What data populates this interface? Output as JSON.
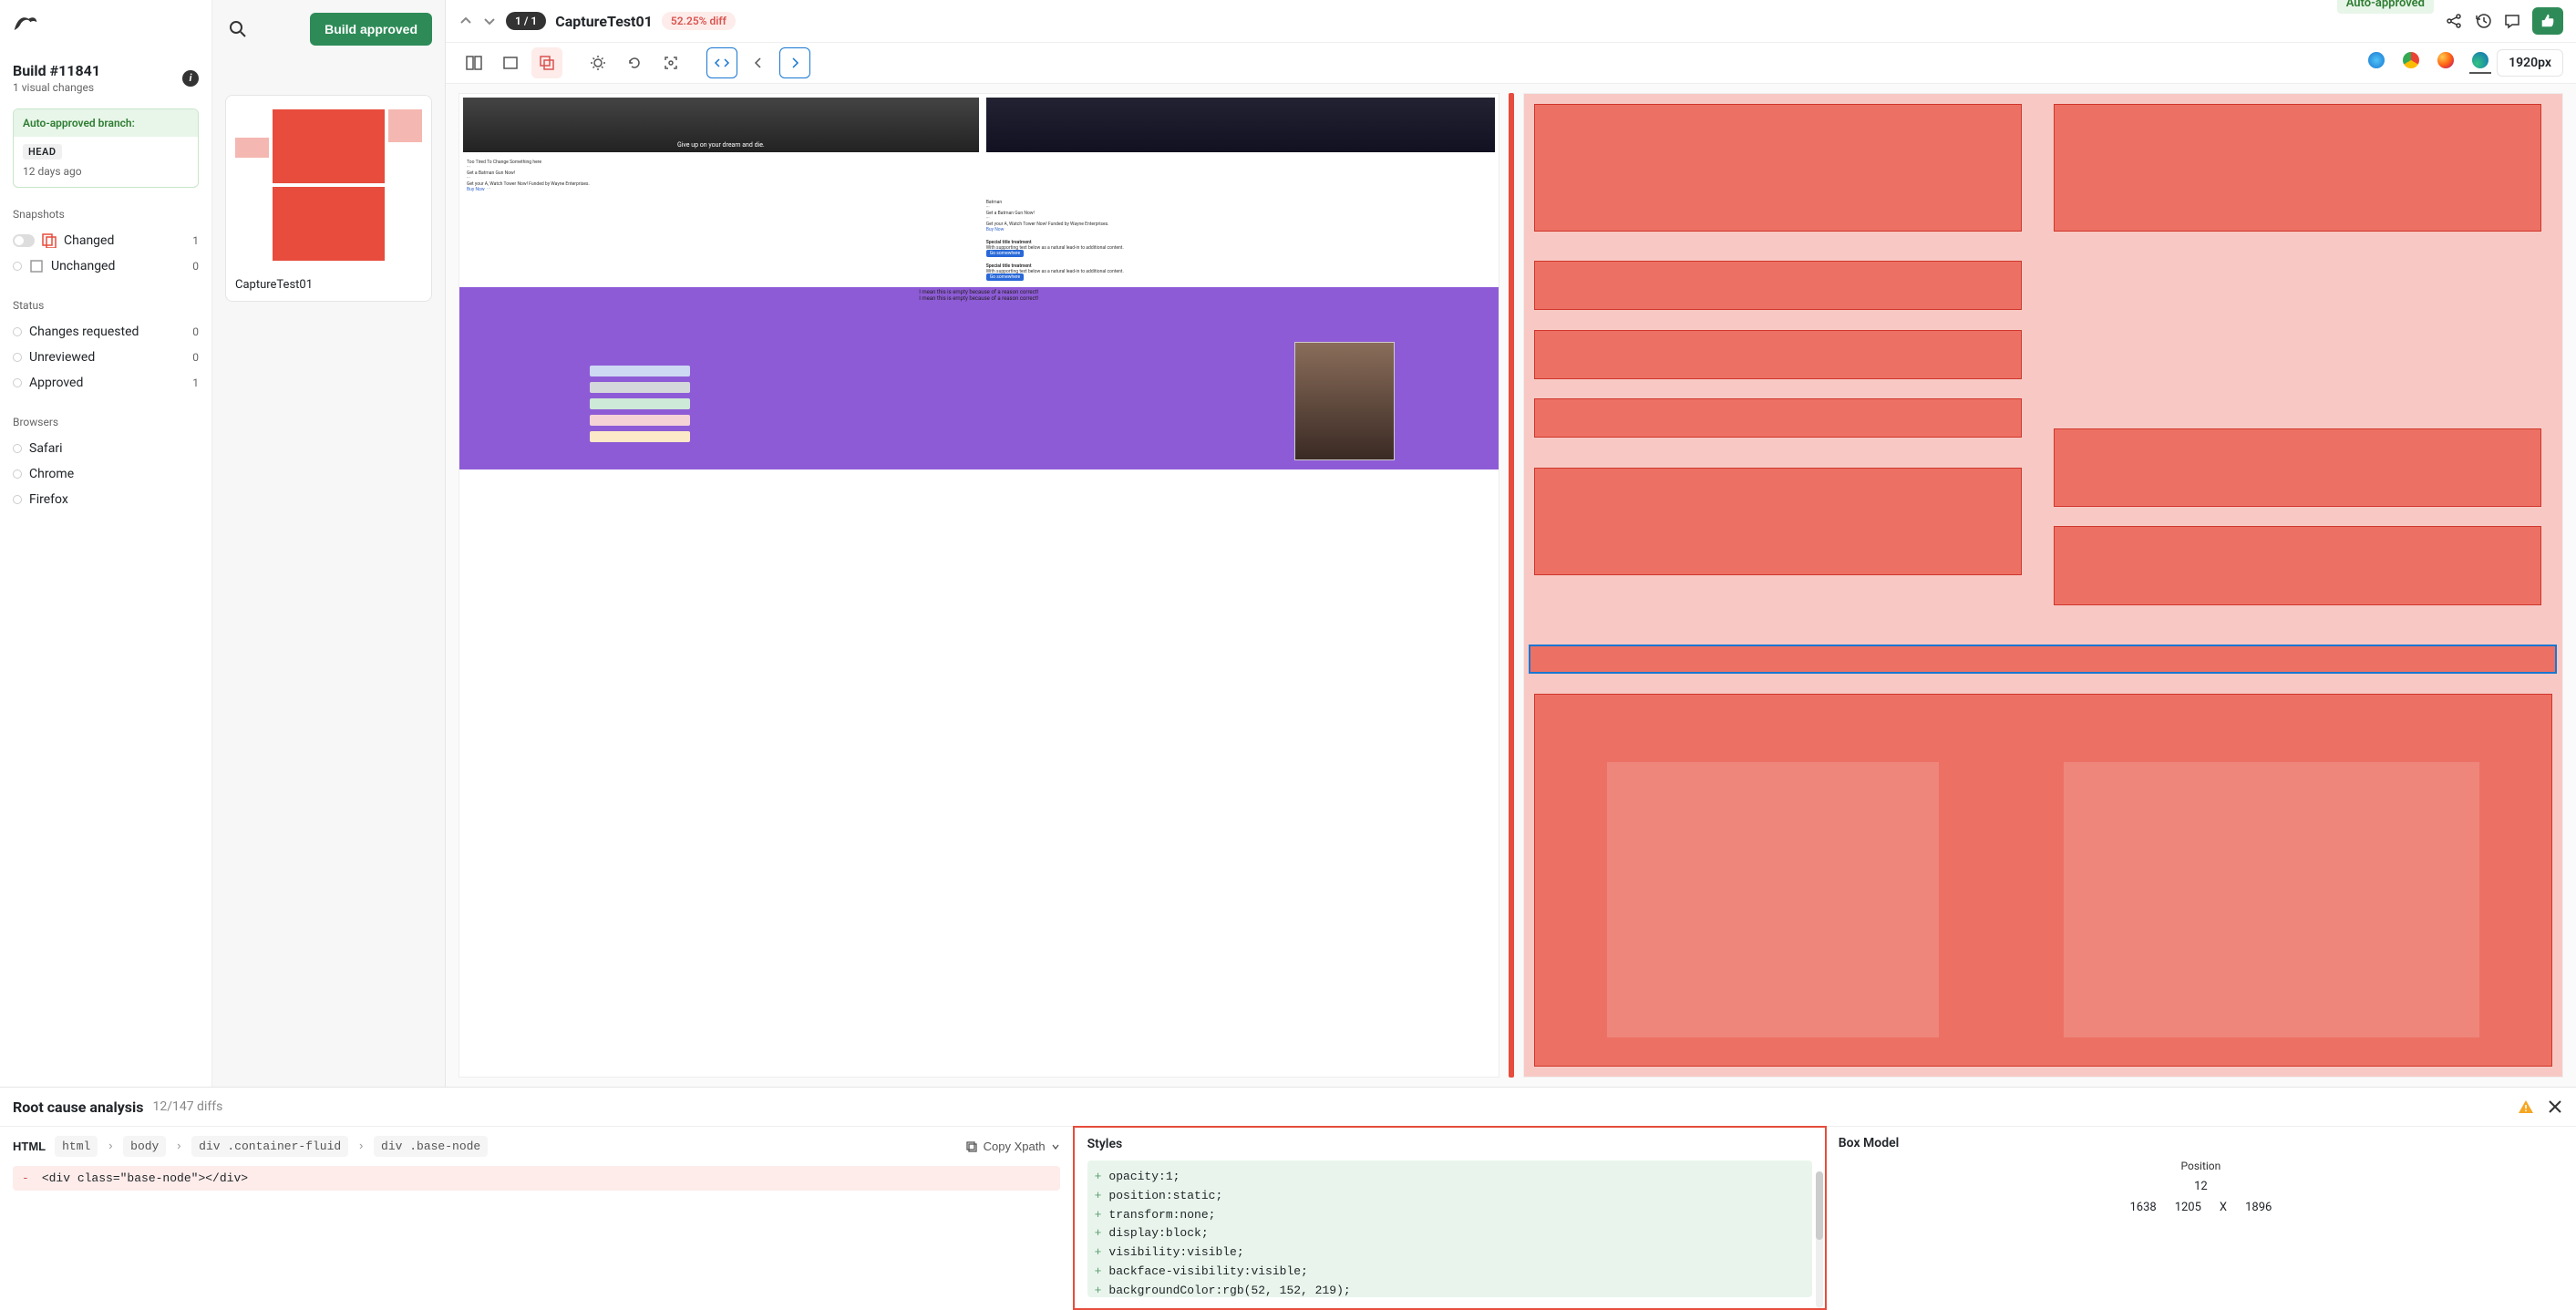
{
  "header": {
    "build_title": "Build #11841",
    "build_sub": "1 visual changes",
    "auto_approved_label": "Auto-approved branch:",
    "branch_name": "HEAD",
    "branch_time": "12 days ago"
  },
  "sidebar": {
    "sections": {
      "snapshots": "Snapshots",
      "status": "Status",
      "browsers": "Browsers"
    },
    "filters": {
      "changed_label": "Changed",
      "changed_count": "1",
      "unchanged_label": "Unchanged",
      "unchanged_count": "0",
      "changes_requested_label": "Changes requested",
      "changes_requested_count": "0",
      "unreviewed_label": "Unreviewed",
      "unreviewed_count": "0",
      "approved_label": "Approved",
      "approved_count": "1",
      "safari": "Safari",
      "chrome": "Chrome",
      "firefox": "Firefox"
    }
  },
  "mid": {
    "build_approved_btn": "Build approved",
    "thumb_caption": "CaptureTest01"
  },
  "main": {
    "counter": "1 / 1",
    "snapshot_name": "CaptureTest01",
    "diff_pct": "52.25% diff",
    "auto_approved_tag": "Auto-approved",
    "viewport": "1920px"
  },
  "rca": {
    "title": "Root cause analysis",
    "count": "12/147 diffs",
    "html_label": "HTML",
    "crumbs": [
      "html",
      "body",
      "div .container-fluid",
      "div .base-node"
    ],
    "copy_xpath": "Copy Xpath",
    "removed_line": "<div class=\"base-node\"></div>",
    "styles_title": "Styles",
    "style_lines": [
      "opacity:1;",
      "position:static;",
      "transform:none;",
      "display:block;",
      "visibility:visible;",
      "backface-visibility:visible;",
      "backgroundColor:rgb(52, 152, 219);"
    ],
    "box_title": "Box Model",
    "box": {
      "position_label": "Position",
      "top": "12",
      "left": "1638",
      "width": "1205",
      "x": "X",
      "height": "1896"
    }
  }
}
